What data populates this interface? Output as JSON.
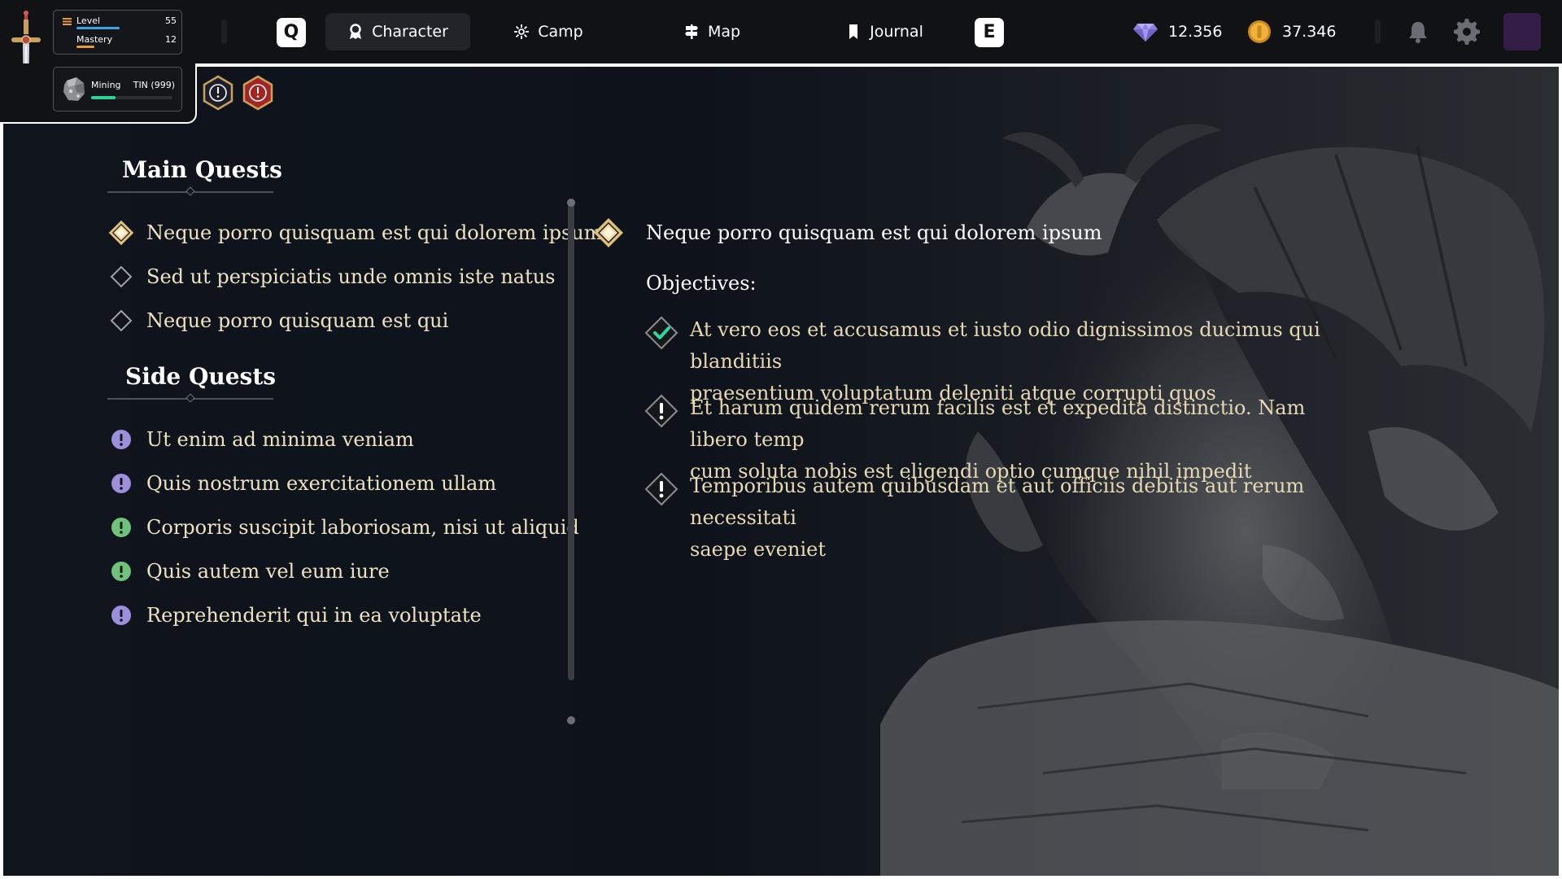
{
  "stats": {
    "level_label": "Level",
    "level_value": "55",
    "level_progress": 0.66,
    "mastery_label": "Mastery",
    "mastery_value": "12",
    "mastery_progress": 0.22,
    "mining_label": "Mining",
    "mining_value": "TIN (999)",
    "mining_progress": 0.3
  },
  "nav": {
    "key_left": "Q",
    "key_right": "E",
    "tabs": [
      {
        "label": "Character",
        "icon": "character-icon",
        "active": true
      },
      {
        "label": "Camp",
        "icon": "camp-icon",
        "active": false
      },
      {
        "label": "Map",
        "icon": "map-icon",
        "active": false
      },
      {
        "label": "Journal",
        "icon": "journal-icon",
        "active": false
      }
    ]
  },
  "currency": {
    "gems": "12.356",
    "coins": "37.346"
  },
  "colors": {
    "accent_gold": "#e0c078",
    "quest_purple": "#9d8fdc",
    "quest_green": "#6fc27a",
    "level_bar": "#38a6e6",
    "mastery_bar": "#e4993a",
    "mining_bar": "#2ed59a",
    "check_green": "#2ed59a"
  },
  "quests": {
    "main_title": "Main Quests",
    "side_title": "Side Quests",
    "main": [
      {
        "label": "Neque porro quisquam est qui dolorem ipsum",
        "icon": "active-quest-icon"
      },
      {
        "label": "Sed ut perspiciatis unde omnis iste natus",
        "icon": "diamond-icon"
      },
      {
        "label": "Neque porro quisquam est qui",
        "icon": "diamond-icon"
      }
    ],
    "side": [
      {
        "label": "Ut enim ad minima veniam",
        "icon": "purple-alert-icon"
      },
      {
        "label": "Quis nostrum exercitationem ullam",
        "icon": "purple-alert-icon"
      },
      {
        "label": "Corporis suscipit laboriosam, nisi ut aliquid",
        "icon": "green-alert-icon"
      },
      {
        "label": "Quis autem vel eum iure",
        "icon": "green-alert-icon"
      },
      {
        "label": "Reprehenderit qui in ea voluptate",
        "icon": "purple-alert-icon"
      }
    ]
  },
  "detail": {
    "title": "Neque porro quisquam est qui dolorem ipsum",
    "objectives_label": "Objectives:",
    "objectives": [
      {
        "line1": "At vero eos et accusamus et iusto odio dignissimos ducimus qui blanditiis",
        "line2": "praesentium voluptatum deleniti atque corrupti quos",
        "status": "complete"
      },
      {
        "line1": "Et harum quidem rerum facilis est et expedita distinctio. Nam libero temp",
        "line2": "cum soluta nobis est eligendi optio cumque nihil impedit",
        "status": "pending"
      },
      {
        "line1": "Temporibus autem quibusdam et aut officiis debitis aut rerum necessitati",
        "line2": "saepe eveniet",
        "status": "pending"
      }
    ]
  }
}
